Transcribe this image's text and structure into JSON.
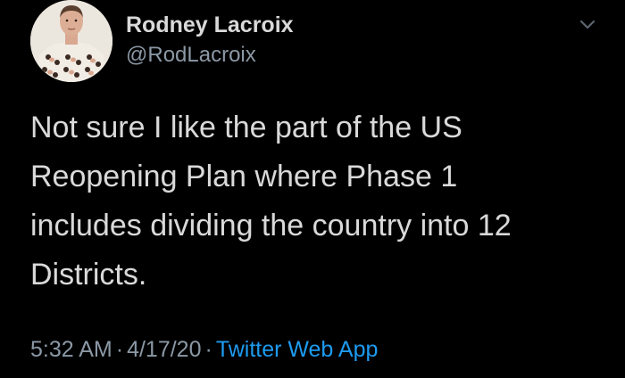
{
  "tweet": {
    "display_name": "Rodney Lacroix",
    "handle": "@RodLacroix",
    "text": "Not sure I like the part of the US\nReopening Plan where Phase 1\nincludes dividing the country into 12\nDistricts.",
    "time": "5:32 AM",
    "date": "4/17/20",
    "separator": "·",
    "source": "Twitter Web App"
  },
  "icons": {
    "avatar": "profile-photo-avatar",
    "menu": "chevron-down-icon"
  },
  "colors": {
    "background": "#000000",
    "primary_text": "#d9d9d9",
    "secondary_text": "#8b98a5",
    "link": "#1d9bf0"
  }
}
